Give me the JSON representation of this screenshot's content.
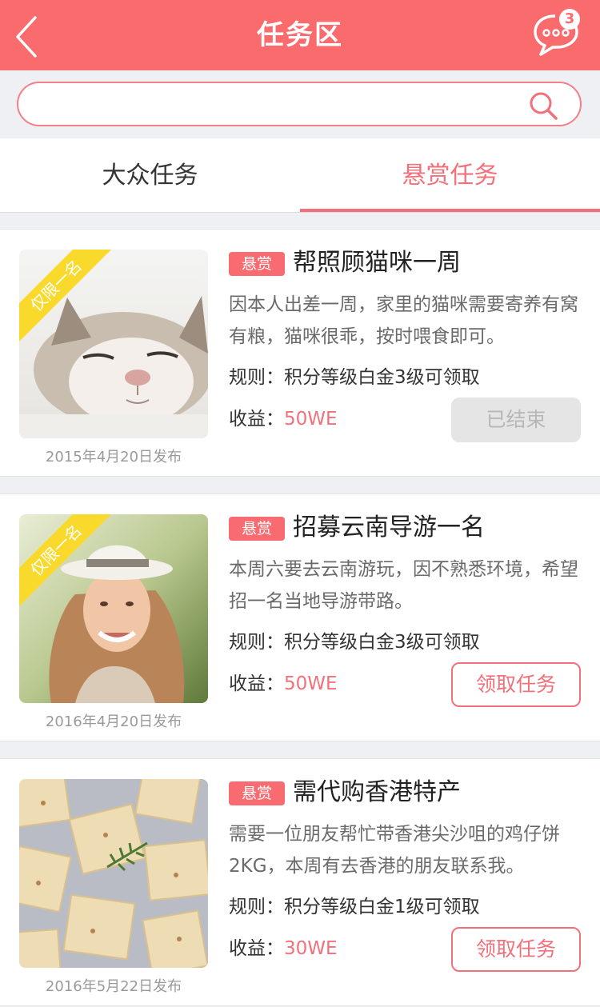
{
  "header": {
    "title": "任务区",
    "badge_count": "3"
  },
  "search": {
    "value": "",
    "placeholder": ""
  },
  "tabs": [
    {
      "label": "大众任务",
      "active": false
    },
    {
      "label": "悬赏任务",
      "active": true
    }
  ],
  "tasks": [
    {
      "ribbon": "仅限一名",
      "tag": "悬赏",
      "title": "帮照顾猫咪一周",
      "description": "因本人出差一周，家里的猫咪需要寄养有窝有粮，猫咪很乖，按时喂食即可。",
      "rule_label": "规则：",
      "rule": "积分等级白金3级可领取",
      "income_label": "收益：",
      "income": "50WE",
      "button": "已结束",
      "button_state": "ended",
      "date": "2015年4月20日发布",
      "image": "cat-photo"
    },
    {
      "ribbon": "仅限一名",
      "tag": "悬赏",
      "title": "招募云南导游一名",
      "description": "本周六要去云南游玩，因不熟悉环境，希望招一名当地导游带路。",
      "rule_label": "规则：",
      "rule": "积分等级白金3级可领取",
      "income_label": "收益：",
      "income": "50WE",
      "button": "领取任务",
      "button_state": "active",
      "date": "2016年4月20日发布",
      "image": "woman-photo"
    },
    {
      "tag": "悬赏",
      "title": "需代购香港特产",
      "description": "需要一位朋友帮忙带香港尖沙咀的鸡仔饼2KG，本周有去香港的朋友联系我。",
      "rule_label": "规则：",
      "rule": "积分等级白金1级可领取",
      "income_label": "收益：",
      "income": "30WE",
      "button": "领取任务",
      "button_state": "active",
      "date": "2016年5月22日发布",
      "image": "cookies-photo"
    }
  ],
  "colors": {
    "accent": "#fa6b6e",
    "ribbon": "#f9d92c",
    "muted": "#9a9a9a"
  }
}
